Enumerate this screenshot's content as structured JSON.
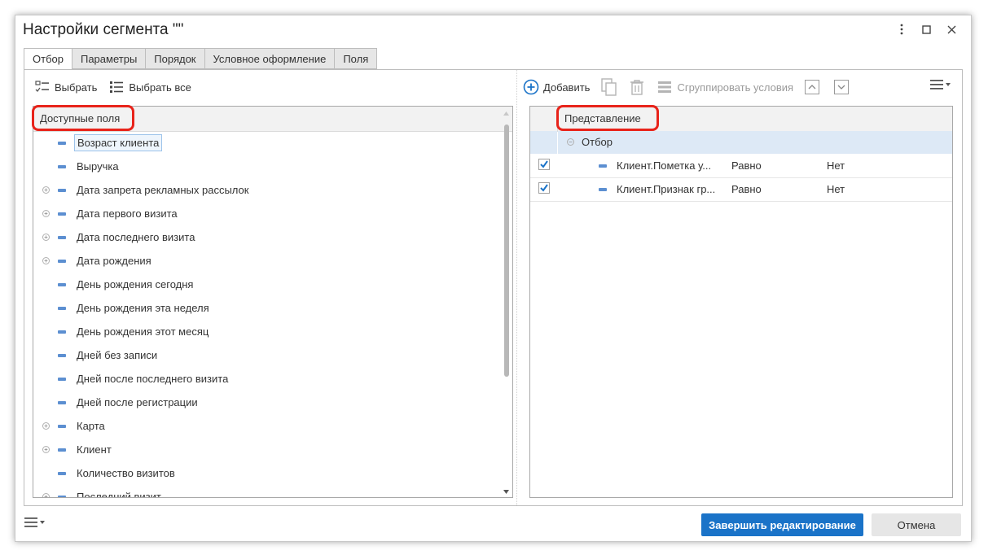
{
  "window": {
    "title": "Настройки сегмента \"\""
  },
  "tabs": [
    {
      "label": "Отбор",
      "active": true
    },
    {
      "label": "Параметры",
      "active": false
    },
    {
      "label": "Порядок",
      "active": false
    },
    {
      "label": "Условное оформление",
      "active": false
    },
    {
      "label": "Поля",
      "active": false
    }
  ],
  "left_toolbar": {
    "select_label": "Выбрать",
    "select_all_label": "Выбрать все"
  },
  "available_fields": {
    "header": "Доступные поля",
    "items": [
      {
        "label": "Возраст клиента",
        "expandable": false,
        "selected": true
      },
      {
        "label": "Выручка",
        "expandable": false,
        "selected": false
      },
      {
        "label": "Дата запрета рекламных рассылок",
        "expandable": true,
        "selected": false
      },
      {
        "label": "Дата первого визита",
        "expandable": true,
        "selected": false
      },
      {
        "label": "Дата последнего визита",
        "expandable": true,
        "selected": false
      },
      {
        "label": "Дата рождения",
        "expandable": true,
        "selected": false
      },
      {
        "label": "День рождения сегодня",
        "expandable": false,
        "selected": false
      },
      {
        "label": "День рождения эта неделя",
        "expandable": false,
        "selected": false
      },
      {
        "label": "День рождения этот месяц",
        "expandable": false,
        "selected": false
      },
      {
        "label": "Дней без записи",
        "expandable": false,
        "selected": false
      },
      {
        "label": "Дней после последнего визита",
        "expandable": false,
        "selected": false
      },
      {
        "label": "Дней после регистрации",
        "expandable": false,
        "selected": false
      },
      {
        "label": "Карта",
        "expandable": true,
        "selected": false
      },
      {
        "label": "Клиент",
        "expandable": true,
        "selected": false
      },
      {
        "label": "Количество визитов",
        "expandable": false,
        "selected": false
      },
      {
        "label": "Последний визит",
        "expandable": true,
        "selected": false
      }
    ]
  },
  "right_toolbar": {
    "add_label": "Добавить",
    "group_label": "Сгруппировать условия"
  },
  "filter": {
    "header": "Представление",
    "group_label": "Отбор",
    "conditions": [
      {
        "checked": true,
        "field": "Клиент.Пометка у...",
        "comparison": "Равно",
        "value": "Нет"
      },
      {
        "checked": true,
        "field": "Клиент.Признак гр...",
        "comparison": "Равно",
        "value": "Нет"
      }
    ]
  },
  "footer": {
    "finish_label": "Завершить редактирование",
    "cancel_label": "Отмена"
  },
  "colors": {
    "primary": "#1a73c8",
    "highlight_ring": "#e8231a",
    "field_marker": "#5c8fd1"
  }
}
